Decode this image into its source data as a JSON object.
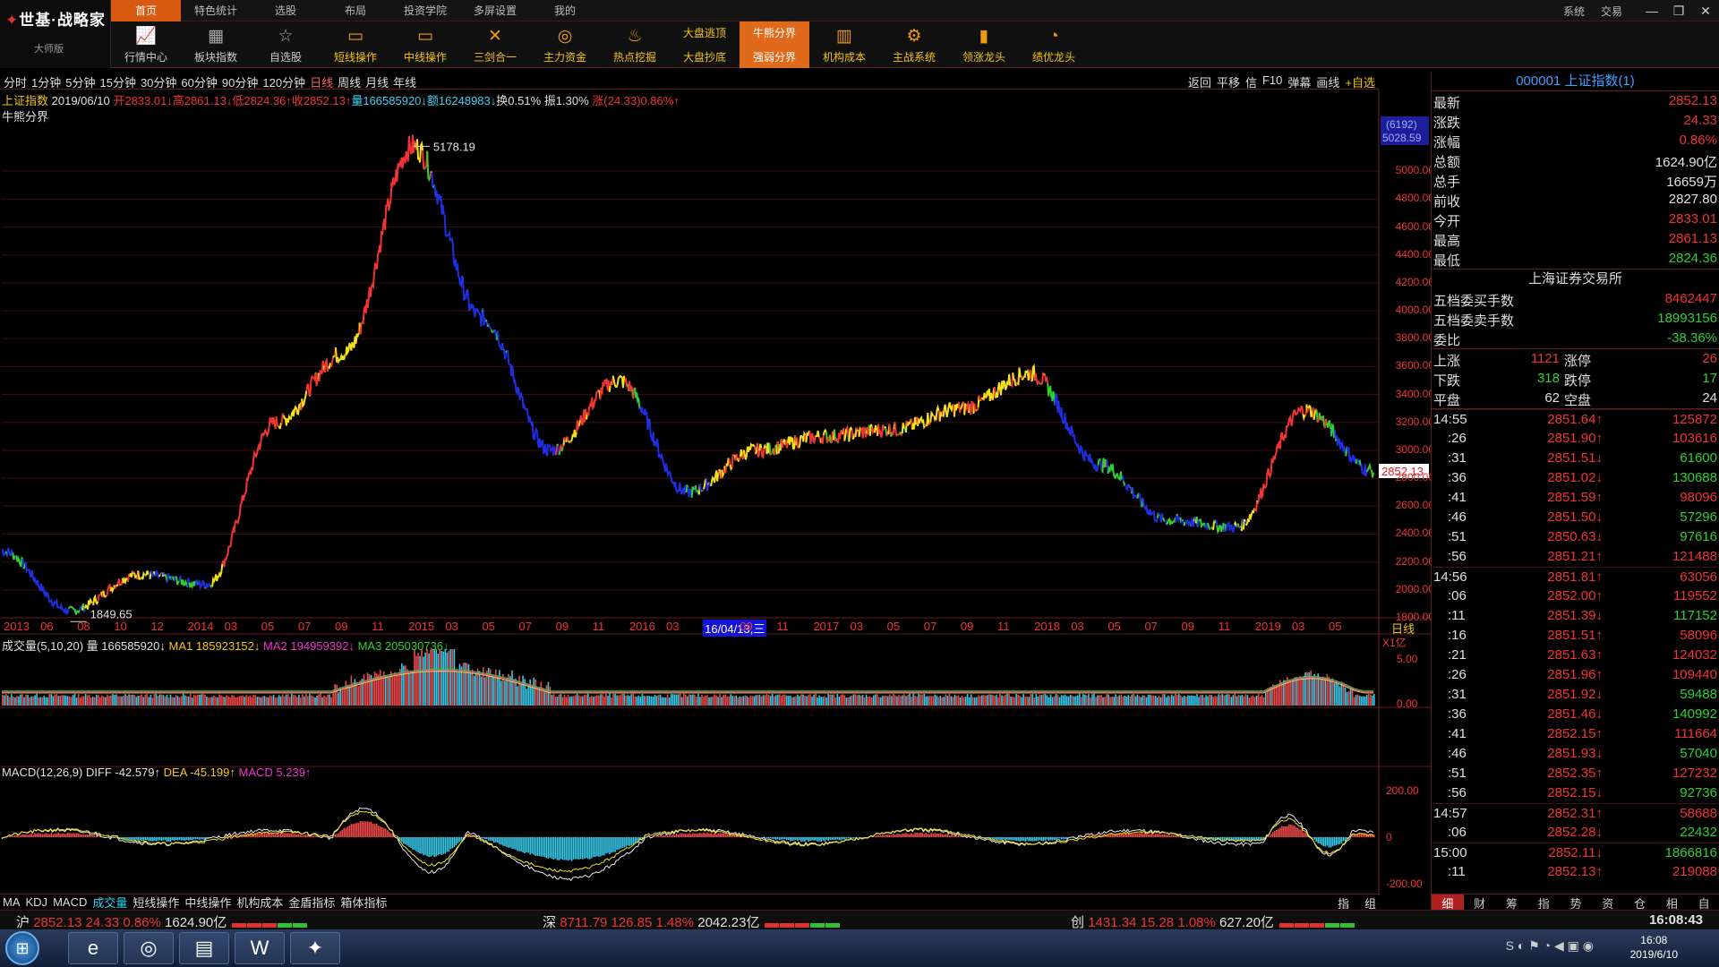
{
  "app": {
    "brand": "世基·战略家",
    "edition": "大师版"
  },
  "menu": [
    "首页",
    "特色统计",
    "选股",
    "布局",
    "投资学院",
    "多屏设置",
    "我的"
  ],
  "top_right": {
    "sys": "系统",
    "trade": "交易"
  },
  "toolbar": [
    {
      "label": "行情中心",
      "icon": "market-icon"
    },
    {
      "label": "板块指数",
      "icon": "sector-icon"
    },
    {
      "label": "自选股",
      "icon": "watchlist-icon"
    },
    {
      "label": "短线操作",
      "icon": "short-term-icon"
    },
    {
      "label": "中线操作",
      "icon": "mid-term-icon"
    },
    {
      "label": "三剑合一",
      "icon": "swords-icon"
    },
    {
      "label": "主力资金",
      "icon": "capital-icon"
    },
    {
      "label": "热点挖掘",
      "icon": "fire-icon"
    },
    {
      "top": "大盘逃顶",
      "bottom": "大盘抄底"
    },
    {
      "top": "牛熊分界",
      "bottom": "强弱分界"
    },
    {
      "label": "机构成本",
      "icon": "institution-icon"
    },
    {
      "label": "主战系统",
      "icon": "gear-icon"
    },
    {
      "label": "领涨龙头",
      "icon": "chart-icon"
    },
    {
      "label": "绩优龙头",
      "icon": "pie-icon"
    }
  ],
  "periods": [
    "分时",
    "1分钟",
    "5分钟",
    "15分钟",
    "30分钟",
    "60分钟",
    "90分钟",
    "120分钟",
    "日线",
    "周线",
    "月线",
    "年线"
  ],
  "current_period": "日线",
  "chart_actions": [
    "返回",
    "平移",
    "信",
    "F10",
    "弹幕",
    "画线",
    "+自选"
  ],
  "chart_info": {
    "name": "上证指数",
    "date": "2019/06/10",
    "open": "开2833.01↓",
    "high": "高2861.13↓",
    "low": "低2824.36↑",
    "close": "收2852.13↑",
    "volume": "量166585920↓",
    "amount": "额16248983↓",
    "turnover": "换0.51%",
    "amplitude": "振1.30%",
    "change": "涨(24.33)0.86%↑"
  },
  "indicator_label": "牛熊分界",
  "axis": {
    "price_labels": [
      "5000.00",
      "4800.00",
      "4600.00",
      "4400.00",
      "4200.00",
      "4000.00",
      "3800.00",
      "3600.00",
      "3400.00",
      "3200.00",
      "3000.00",
      "2800.00",
      "2600.00",
      "2400.00",
      "2200.00",
      "2000.00",
      "1800.00"
    ],
    "counter": "(6192)",
    "counter_price": "5028.59",
    "last_price_tag": "2852.13",
    "high_annot": "5178.19",
    "low_annot": "1849.65",
    "x_labels": [
      "2013",
      "06",
      "08",
      "10",
      "12",
      "2014",
      "03",
      "05",
      "07",
      "09",
      "11",
      "2015",
      "03",
      "05",
      "07",
      "09",
      "11",
      "2016",
      "03",
      "16/04/13,三",
      "09",
      "11",
      "2017",
      "03",
      "05",
      "07",
      "09",
      "11",
      "2018",
      "03",
      "05",
      "07",
      "09",
      "11",
      "2019",
      "03",
      "05"
    ],
    "x_period": "日线",
    "vol_unit": "X1亿",
    "vol_ticks": [
      "5.00",
      "0.00"
    ],
    "macd_ticks": [
      "200.00",
      "0",
      "-200.00"
    ]
  },
  "volume_info": {
    "label": "成交量(5,10,20)",
    "vol": "量 166585920↓",
    "ma1": "MA1 185923152↓",
    "ma2": "MA2 194959392↓",
    "ma3": "MA3 205030736↓"
  },
  "macd_info": {
    "label": "MACD(12,26,9)",
    "diff": "DIFF -42.579↑",
    "dea": "DEA -45.199↑",
    "macd": "MACD 5.239↑"
  },
  "bottom_tabs": [
    "MA",
    "KDJ",
    "MACD",
    "成交量",
    "短线操作",
    "中线操作",
    "机构成本",
    "金盾指标",
    "箱体指标"
  ],
  "bottom_tabs_current": "成交量",
  "bottom_right": [
    "指",
    "组"
  ],
  "panel": {
    "title": "000001 上证指数(1)",
    "quote": [
      {
        "k": "最新",
        "v": "2852.13",
        "c": "r"
      },
      {
        "k": "涨跌",
        "v": "24.33",
        "c": "r"
      },
      {
        "k": "涨幅",
        "v": "0.86%",
        "c": "r"
      },
      {
        "k": "总额",
        "v": "1624.90亿",
        "c": "w"
      },
      {
        "k": "总手",
        "v": "16659万",
        "c": "w"
      },
      {
        "k": "前收",
        "v": "2827.80",
        "c": "w"
      },
      {
        "k": "今开",
        "v": "2833.01",
        "c": "r"
      },
      {
        "k": "最高",
        "v": "2861.13",
        "c": "r"
      },
      {
        "k": "最低",
        "v": "2824.36",
        "c": "g"
      }
    ],
    "exchange": "上海证券交易所",
    "orders": [
      {
        "k": "五档委买手数",
        "v": "8462447",
        "c": "r"
      },
      {
        "k": "五档委卖手数",
        "v": "18993156",
        "c": "g"
      },
      {
        "k": "委比",
        "v": "-38.36%",
        "c": "g"
      }
    ],
    "advance": [
      {
        "a": "上涨",
        "b": "1121",
        "b_c": "r",
        "c": "涨停",
        "d": "26",
        "d_c": "r"
      },
      {
        "a": "下跌",
        "b": "318",
        "b_c": "g",
        "c": "跌停",
        "d": "17",
        "d_c": "g"
      },
      {
        "a": "平盘",
        "b": "62",
        "b_c": "w",
        "c": "空盘",
        "d": "24",
        "d_c": "w"
      }
    ],
    "ticks": [
      {
        "t": "14:55",
        "p": "2851.64↑",
        "pc": "r",
        "v": "125872",
        "vc": "r"
      },
      {
        "t": ":26",
        "p": "2851.90↑",
        "pc": "r",
        "v": "103616",
        "vc": "r"
      },
      {
        "t": ":31",
        "p": "2851.51↓",
        "pc": "r",
        "v": "61600",
        "vc": "g"
      },
      {
        "t": ":36",
        "p": "2851.02↓",
        "pc": "r",
        "v": "130688",
        "vc": "g"
      },
      {
        "t": ":41",
        "p": "2851.59↑",
        "pc": "r",
        "v": "98096",
        "vc": "r"
      },
      {
        "t": ":46",
        "p": "2851.50↓",
        "pc": "r",
        "v": "57296",
        "vc": "g"
      },
      {
        "t": ":51",
        "p": "2850.63↓",
        "pc": "r",
        "v": "97616",
        "vc": "g"
      },
      {
        "t": ":56",
        "p": "2851.21↑",
        "pc": "r",
        "v": "121488",
        "vc": "r"
      },
      {
        "t": "14:56",
        "p": "2851.81↑",
        "pc": "r",
        "v": "63056",
        "vc": "r"
      },
      {
        "t": ":06",
        "p": "2852.00↑",
        "pc": "r",
        "v": "119552",
        "vc": "r"
      },
      {
        "t": ":11",
        "p": "2851.39↓",
        "pc": "r",
        "v": "117152",
        "vc": "g"
      },
      {
        "t": ":16",
        "p": "2851.51↑",
        "pc": "r",
        "v": "58096",
        "vc": "r"
      },
      {
        "t": ":21",
        "p": "2851.63↑",
        "pc": "r",
        "v": "124032",
        "vc": "r"
      },
      {
        "t": ":26",
        "p": "2851.96↑",
        "pc": "r",
        "v": "109440",
        "vc": "r"
      },
      {
        "t": ":31",
        "p": "2851.92↓",
        "pc": "r",
        "v": "59488",
        "vc": "g"
      },
      {
        "t": ":36",
        "p": "2851.46↓",
        "pc": "r",
        "v": "140992",
        "vc": "g"
      },
      {
        "t": ":41",
        "p": "2852.15↑",
        "pc": "r",
        "v": "111664",
        "vc": "r"
      },
      {
        "t": ":46",
        "p": "2851.93↓",
        "pc": "r",
        "v": "57040",
        "vc": "g"
      },
      {
        "t": ":51",
        "p": "2852.35↑",
        "pc": "r",
        "v": "127232",
        "vc": "r"
      },
      {
        "t": ":56",
        "p": "2852.15↓",
        "pc": "r",
        "v": "92736",
        "vc": "g"
      },
      {
        "t": "14:57",
        "p": "2852.31↑",
        "pc": "r",
        "v": "58688",
        "vc": "r"
      },
      {
        "t": ":06",
        "p": "2852.28↓",
        "pc": "r",
        "v": "22432",
        "vc": "g"
      },
      {
        "t": "15:00",
        "p": "2852.11↓",
        "pc": "r",
        "v": "1866816",
        "vc": "g"
      },
      {
        "t": ":11",
        "p": "2852.13↑",
        "pc": "r",
        "v": "219088",
        "vc": "r"
      }
    ],
    "tabs": [
      "细",
      "财",
      "筹",
      "指",
      "势",
      "资",
      "仓",
      "相",
      "自"
    ],
    "tab_current": "细"
  },
  "status": [
    {
      "mk": "沪",
      "price": "2852.13",
      "chg": "24.33",
      "pct": "0.86%",
      "amt": "1624.90亿"
    },
    {
      "mk": "深",
      "price": "8711.79",
      "chg": "126.85",
      "pct": "1.48%",
      "amt": "2042.23亿"
    },
    {
      "mk": "创",
      "price": "1431.34",
      "chg": "15.28",
      "pct": "1.08%",
      "amt": "627.20亿"
    }
  ],
  "status_time": "16:08:43",
  "taskbar": {
    "time": "16:08",
    "date": "2019/6/10"
  },
  "colors": {
    "up": "#f03434",
    "down": "#30d030",
    "accent": "#d85a10",
    "bear": "#1e2ee0",
    "weak": "#f3e01a",
    "panel_title": "#4a9cff"
  },
  "chart_data": {
    "type": "line",
    "title": "上证指数",
    "ylim": [
      1800,
      5200
    ],
    "x": [
      "2013-01",
      "2013-06",
      "2013-12",
      "2014-06",
      "2014-12",
      "2015-03",
      "2015-06-12",
      "2015-07",
      "2015-08",
      "2015-12",
      "2016-01",
      "2016-04",
      "2016-12",
      "2017-06",
      "2017-12",
      "2018-01",
      "2018-06",
      "2018-10",
      "2019-01",
      "2019-04",
      "2019-06-10"
    ],
    "series": [
      {
        "values": [
          2280,
          1849.65,
          2110,
          2040,
          3200,
          3700,
          5178.19,
          3950,
          3000,
          3500,
          2700,
          3000,
          3100,
          3150,
          3300,
          3550,
          2900,
          2500,
          2450,
          3288,
          2852.13
        ]
      }
    ],
    "segment_colors": {
      "bull": "#f03434",
      "strong": "#30d030",
      "weak": "#f3e01a",
      "bear": "#1e2ee0"
    },
    "volume": {
      "unit": "X1亿",
      "ylim": [
        0,
        8.5
      ]
    },
    "macd": {
      "ylim": [
        -250,
        250
      ],
      "diff": -42.579,
      "dea": -45.199,
      "macd": 5.239
    }
  }
}
